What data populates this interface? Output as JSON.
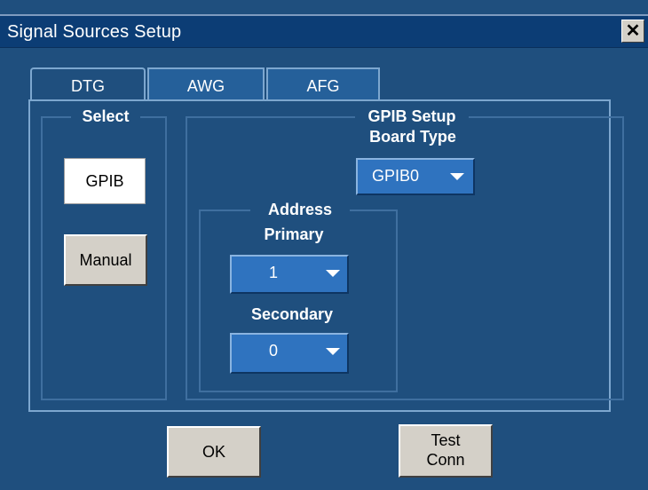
{
  "window": {
    "title": "Signal Sources Setup",
    "close_glyph": "✕"
  },
  "tabs": [
    {
      "label": "DTG",
      "active": true
    },
    {
      "label": "AWG",
      "active": false
    },
    {
      "label": "AFG",
      "active": false
    }
  ],
  "select_group": {
    "label": "Select",
    "buttons": [
      {
        "label": "GPIB",
        "selected": true
      },
      {
        "label": "Manual",
        "selected": false
      }
    ]
  },
  "gpib_setup": {
    "label": "GPIB Setup",
    "board_type": {
      "label": "Board Type",
      "value": "GPIB0"
    },
    "address": {
      "label": "Address",
      "primary": {
        "label": "Primary",
        "value": "1"
      },
      "secondary": {
        "label": "Secondary",
        "value": "0"
      }
    }
  },
  "footer": {
    "ok_label": "OK",
    "test_conn_line1": "Test",
    "test_conn_line2": "Conn"
  },
  "colors": {
    "background": "#1f4f7e",
    "titlebar": "#0c3d75",
    "dropdown": "#2f73bf",
    "tab_border": "#7da7cf"
  }
}
